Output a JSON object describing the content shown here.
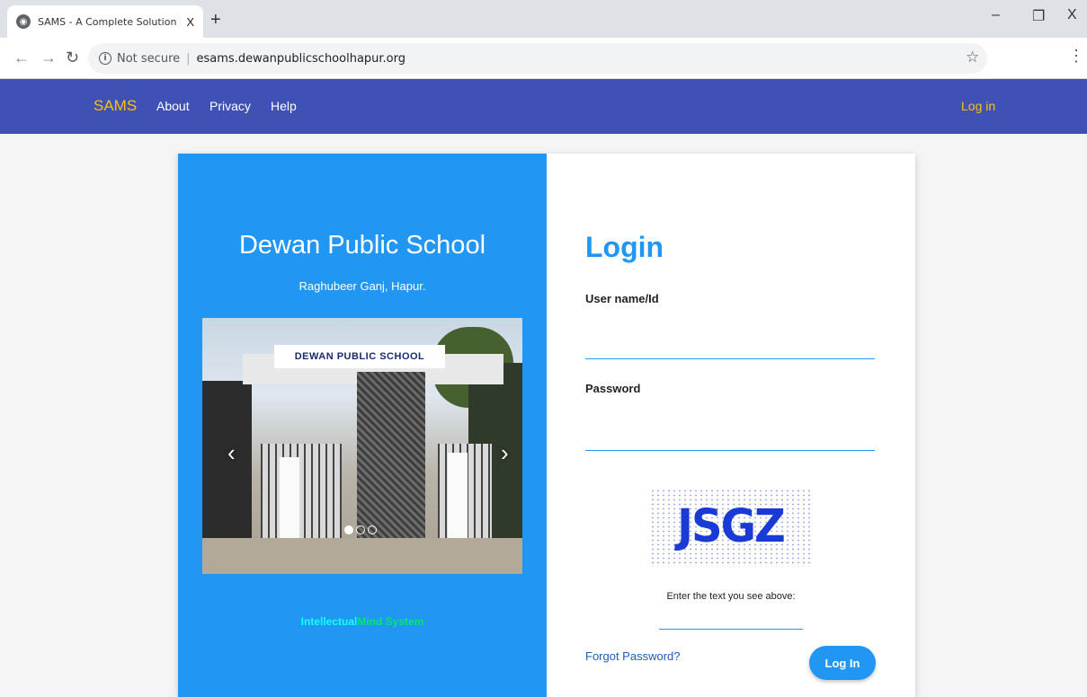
{
  "browser": {
    "tab_title": "SAMS - A Complete Solution For",
    "tab_close": "X",
    "new_tab": "+",
    "not_secure": "Not secure",
    "url": "esams.dewanpublicschoolhapur.org",
    "window_controls": {
      "minimize": "–",
      "restore": "❐",
      "close": "X"
    }
  },
  "nav": {
    "brand": "SAMS",
    "links": [
      "About",
      "Privacy",
      "Help"
    ],
    "login": "Log in"
  },
  "school": {
    "name": "Dewan Public School",
    "address": "Raghubeer Ganj, Hapur.",
    "carousel": {
      "banner_text": "DEWAN PUBLIC SCHOOL",
      "slides": 3,
      "active_slide": 1
    },
    "tagline_part1": "Intellectual",
    "tagline_part2": "Mind System"
  },
  "login": {
    "title": "Login",
    "username_label": "User name/Id",
    "username_value": "",
    "password_label": "Password",
    "password_value": "",
    "captcha_text": "JSGZ",
    "captcha_hint": "Enter the text you see above:",
    "captcha_value": "",
    "forgot": "Forgot Password?",
    "button": "Log In"
  },
  "icons": {
    "favicon": "globe-icon",
    "back": "back-arrow-icon",
    "forward": "forward-arrow-icon",
    "reload": "reload-icon",
    "info": "info-icon",
    "star": "star-icon",
    "menu": "kebab-menu-icon"
  },
  "colors": {
    "navbar": "#3f51b5",
    "brand": "#ffc107",
    "panel": "#2196f3",
    "accent": "#2196f3"
  }
}
